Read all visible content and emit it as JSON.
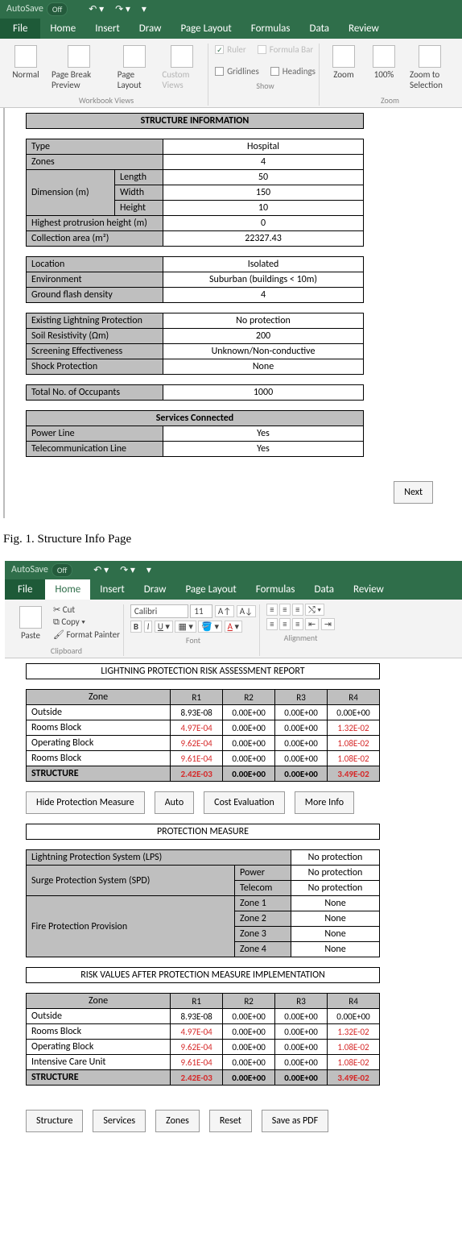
{
  "fig1": {
    "titlebar": {
      "autosave_label": "AutoSave",
      "autosave_state": "Off"
    },
    "tabs": {
      "file": "File",
      "home": "Home",
      "insert": "Insert",
      "draw": "Draw",
      "page_layout": "Page Layout",
      "formulas": "Formulas",
      "data": "Data",
      "review": "Review"
    },
    "ribbon": {
      "view_buttons": {
        "normal": "Normal",
        "page_break": "Page Break Preview",
        "page_layout": "Page Layout",
        "custom": "Custom Views"
      },
      "group1_label": "Workbook Views",
      "show": {
        "ruler": "Ruler",
        "formula_bar": "Formula Bar",
        "gridlines": "Gridlines",
        "headings": "Headings",
        "label": "Show"
      },
      "zoom": {
        "zoom": "Zoom",
        "hundred": "100%",
        "zoom_sel": "Zoom to Selection",
        "label": "Zoom"
      }
    },
    "tables": {
      "structure_info_title": "STRUCTURE INFORMATION",
      "type_label": "Type",
      "type_value": "Hospital",
      "zones_label": "Zones",
      "zones_value": "4",
      "dimension_label": "Dimension (m)",
      "length_label": "Length",
      "length_value": "50",
      "width_label": "Width",
      "width_value": "150",
      "height_label": "Height",
      "height_value": "10",
      "protrusion_label": "Highest protrusion height (m)",
      "protrusion_value": "0",
      "collection_label": "Collection area (m²)",
      "collection_value": "22327.43",
      "location_label": "Location",
      "location_value": "Isolated",
      "environment_label": "Environment",
      "environment_value": "Suburban (buildings < 10m)",
      "gfd_label": "Ground flash density",
      "gfd_value": "4",
      "elp_label": "Existing Lightning Protection",
      "elp_value": "No protection",
      "soil_label": "Soil Resistivity (Ωm)",
      "soil_value": "200",
      "screening_label": "Screening Effectiveness",
      "screening_value": "Unknown/Non-conductive",
      "shock_label": "Shock Protection",
      "shock_value": "None",
      "occupants_label": "Total No. of Occupants",
      "occupants_value": "1000",
      "services_title": "Services Connected",
      "power_label": "Power Line",
      "power_value": "Yes",
      "telecom_label": "Telecommunication Line",
      "telecom_value": "Yes"
    },
    "next_btn": "Next",
    "caption": "Fig. 1.   Structure Info Page"
  },
  "fig2": {
    "titlebar": {
      "autosave_label": "AutoSave",
      "autosave_state": "Off"
    },
    "tabs": {
      "file": "File",
      "home": "Home",
      "insert": "Insert",
      "draw": "Draw",
      "page_layout": "Page Layout",
      "formulas": "Formulas",
      "data": "Data",
      "review": "Review"
    },
    "ribbon": {
      "cut": "Cut",
      "copy": "Copy",
      "format_painter": "Format Painter",
      "paste": "Paste",
      "clipboard_label": "Clipboard",
      "font_name": "Calibri",
      "font_size": "11",
      "font_label": "Font",
      "alignment_label": "Alignment"
    },
    "report_title": "LIGHTNING PROTECTION RISK ASSESSMENT REPORT",
    "risk_cols": {
      "zone": "Zone",
      "r1": "R1",
      "r2": "R2",
      "r3": "R3",
      "r4": "R4"
    },
    "risk_rows": [
      {
        "zone": "Outside",
        "r1": "8.93E-08",
        "r2": "0.00E+00",
        "r3": "0.00E+00",
        "r4": "0.00E+00",
        "r1_red": false,
        "r4_red": false
      },
      {
        "zone": "Rooms Block",
        "r1": "4.97E-04",
        "r2": "0.00E+00",
        "r3": "0.00E+00",
        "r4": "1.32E-02",
        "r1_red": true,
        "r4_red": true
      },
      {
        "zone": "Operating Block",
        "r1": "9.62E-04",
        "r2": "0.00E+00",
        "r3": "0.00E+00",
        "r4": "1.08E-02",
        "r1_red": true,
        "r4_red": true
      },
      {
        "zone": "Rooms Block",
        "r1": "9.61E-04",
        "r2": "0.00E+00",
        "r3": "0.00E+00",
        "r4": "1.08E-02",
        "r1_red": true,
        "r4_red": true
      },
      {
        "zone": "STRUCTURE",
        "r1": "2.42E-03",
        "r2": "0.00E+00",
        "r3": "0.00E+00",
        "r4": "3.49E-02",
        "r1_red": true,
        "r4_red": true,
        "bold": true
      }
    ],
    "buttons1": {
      "hide": "Hide Protection Measure",
      "auto": "Auto",
      "cost": "Cost Evaluation",
      "more": "More Info"
    },
    "pm_title": "PROTECTION MEASURE",
    "pm": {
      "lps_label": "Lightning Protection System (LPS)",
      "lps_value": "No protection",
      "spd_label": "Surge Protection System (SPD)",
      "spd_power_label": "Power",
      "spd_power_value": "No protection",
      "spd_telecom_label": "Telecom",
      "spd_telecom_value": "No protection",
      "fire_label": "Fire Protection Provision",
      "zone1_label": "Zone 1",
      "zone1_value": "None",
      "zone2_label": "Zone 2",
      "zone2_value": "None",
      "zone3_label": "Zone 3",
      "zone3_value": "None",
      "zone4_label": "Zone 4",
      "zone4_value": "None"
    },
    "after_title": "RISK VALUES AFTER PROTECTION MEASURE IMPLEMENTATION",
    "after_rows": [
      {
        "zone": "Outside",
        "r1": "8.93E-08",
        "r2": "0.00E+00",
        "r3": "0.00E+00",
        "r4": "0.00E+00",
        "r1_red": false,
        "r4_red": false
      },
      {
        "zone": "Rooms Block",
        "r1": "4.97E-04",
        "r2": "0.00E+00",
        "r3": "0.00E+00",
        "r4": "1.32E-02",
        "r1_red": true,
        "r4_red": true
      },
      {
        "zone": "Operating Block",
        "r1": "9.62E-04",
        "r2": "0.00E+00",
        "r3": "0.00E+00",
        "r4": "1.08E-02",
        "r1_red": true,
        "r4_red": true
      },
      {
        "zone": "Intensive Care Unit",
        "r1": "9.61E-04",
        "r2": "0.00E+00",
        "r3": "0.00E+00",
        "r4": "1.08E-02",
        "r1_red": true,
        "r4_red": true
      },
      {
        "zone": "STRUCTURE",
        "r1": "2.42E-03",
        "r2": "0.00E+00",
        "r3": "0.00E+00",
        "r4": "3.49E-02",
        "r1_red": true,
        "r4_red": true,
        "bold": true
      }
    ],
    "buttons2": {
      "structure": "Structure",
      "services": "Services",
      "zones": "Zones",
      "reset": "Reset",
      "save": "Save as PDF"
    }
  }
}
